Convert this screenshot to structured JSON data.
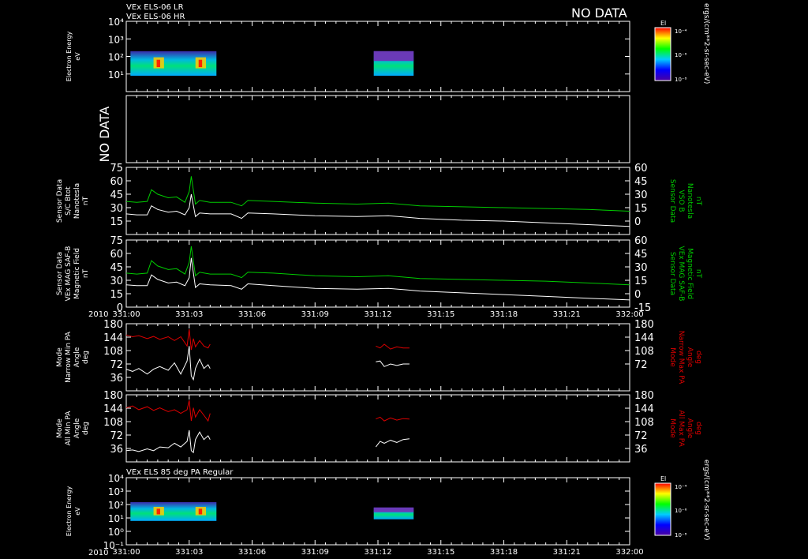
{
  "header": {
    "line1": "VEx ELS-06 LR",
    "line2": "VEx ELS-06 HR",
    "no_data": "NO DATA"
  },
  "bottom_title": "VEx ELS 85 deg PA Regular",
  "year": "2010",
  "colorbar": {
    "title": "El",
    "ticks": [
      "10⁻⁴",
      "10⁻⁶",
      "10⁻⁸"
    ],
    "unit_label": "ergs/(cm**2-sr-sec-eV)"
  },
  "colors": {
    "background": "#000000",
    "primary_trace": "#ffffff",
    "green_trace": "#00cc00",
    "red_trace": "#dd0000"
  },
  "chart_data": [
    {
      "type": "heatmap",
      "id": "energy_top",
      "ylabel": [
        "Electron Energy",
        "eV"
      ],
      "ytick_labels": [
        "10⁴",
        "10³",
        "10²",
        "10¹"
      ],
      "yscale": "log",
      "ylim": [
        1,
        10000
      ],
      "time_blocks": [
        {
          "start": "331:00.2",
          "end": "331:04.3",
          "energy_low_eV": 8,
          "energy_high_eV": 200
        },
        {
          "start": "331:11.8",
          "end": "331:13.7",
          "energy_low_eV": 8,
          "energy_high_eV": 200
        }
      ]
    },
    {
      "type": "empty",
      "id": "no_data_panel",
      "label": "NO DATA"
    },
    {
      "type": "line",
      "id": "sc_bmag",
      "ylabel_left": [
        "Sensor Data",
        "S/C Btot",
        "Nanotesla",
        "nT"
      ],
      "ylabel_right": [
        "Sensor Data",
        "VSO B",
        "Nanotesla",
        "nT"
      ],
      "yticks_left": [
        15,
        30,
        45,
        60,
        75
      ],
      "yticks_right": [
        0,
        15,
        30,
        45,
        60
      ],
      "ylim": [
        0,
        75
      ],
      "series": [
        {
          "color": "white",
          "x": [
            0,
            0.5,
            1.0,
            1.2,
            1.5,
            2.0,
            2.4,
            2.8,
            3.0,
            3.1,
            3.3,
            3.5,
            4.0,
            5.0,
            5.5,
            5.8,
            7.0,
            9.0,
            11.0,
            12.5,
            14.0,
            16.0,
            18.0,
            20.0,
            22.0,
            24.0
          ],
          "y": [
            23,
            22,
            22,
            32,
            28,
            25,
            26,
            22,
            30,
            45,
            20,
            24,
            23,
            23,
            18,
            24,
            23,
            21,
            20,
            21,
            18,
            16,
            15,
            13,
            11,
            9
          ]
        },
        {
          "color": "green",
          "x": [
            0,
            0.5,
            1.0,
            1.2,
            1.5,
            2.0,
            2.4,
            2.8,
            3.0,
            3.1,
            3.3,
            3.5,
            4.0,
            5.0,
            5.5,
            5.8,
            7.0,
            9.0,
            11.0,
            12.5,
            14.0,
            16.0,
            18.0,
            20.0,
            22.0,
            24.0
          ],
          "y": [
            37,
            36,
            37,
            50,
            45,
            41,
            42,
            36,
            48,
            65,
            34,
            38,
            36,
            36,
            32,
            38,
            37,
            35,
            34,
            35,
            32,
            31,
            30,
            29,
            28,
            26
          ]
        }
      ]
    },
    {
      "type": "line",
      "id": "mag_saf",
      "ylabel_left": [
        "Sensor Data",
        "VEx MAG SAF-B",
        "Magnetic Field",
        "nT"
      ],
      "ylabel_right": [
        "Sensor Data",
        "VEx MAG SAF-B",
        "Magnetic Field",
        "nT"
      ],
      "yticks_left": [
        0,
        15,
        30,
        45,
        60,
        75
      ],
      "yticks_right": [
        -15,
        0,
        15,
        30,
        45,
        60
      ],
      "ylim": [
        0,
        75
      ],
      "series": [
        {
          "color": "white",
          "x": [
            0,
            0.5,
            1.0,
            1.2,
            1.5,
            2.0,
            2.4,
            2.8,
            3.0,
            3.1,
            3.3,
            3.5,
            4.0,
            5.0,
            5.5,
            5.8,
            7.0,
            9.0,
            11.0,
            12.5,
            14.0,
            16.0,
            18.0,
            20.0,
            22.0,
            24.0
          ],
          "y": [
            25,
            24,
            24,
            36,
            31,
            27,
            28,
            24,
            33,
            55,
            22,
            26,
            25,
            24,
            20,
            26,
            24,
            21,
            20,
            21,
            18,
            16,
            14,
            12,
            10,
            8
          ]
        },
        {
          "color": "green",
          "x": [
            0,
            0.5,
            1.0,
            1.2,
            1.5,
            2.0,
            2.4,
            2.8,
            3.0,
            3.1,
            3.3,
            3.5,
            4.0,
            5.0,
            5.5,
            5.8,
            7.0,
            9.0,
            11.0,
            12.5,
            14.0,
            16.0,
            18.0,
            20.0,
            22.0,
            24.0
          ],
          "y": [
            38,
            37,
            38,
            52,
            46,
            42,
            43,
            37,
            50,
            68,
            35,
            39,
            37,
            37,
            33,
            39,
            38,
            35,
            34,
            35,
            32,
            31,
            30,
            29,
            27,
            25
          ]
        }
      ]
    },
    {
      "type": "line",
      "id": "narrow_pa",
      "ylabel_left": [
        "Mode",
        "Narrow Min PA",
        "Angle",
        "deg"
      ],
      "ylabel_right": [
        "Mode",
        "Narrow Max PA",
        "Angle",
        "deg"
      ],
      "yticks_left": [
        36,
        72,
        108,
        144,
        180
      ],
      "yticks_right": [
        72,
        108,
        144,
        180
      ],
      "ylim": [
        0,
        180
      ],
      "series": [
        {
          "color": "white",
          "segments": [
            {
              "x": [
                0,
                0.3,
                0.6,
                1.0,
                1.3,
                1.6,
                2.0,
                2.3,
                2.6,
                2.9,
                3.0,
                3.1,
                3.2,
                3.3,
                3.5,
                3.7,
                3.9,
                4.0
              ],
              "y": [
                58,
                52,
                60,
                45,
                58,
                65,
                55,
                75,
                45,
                80,
                120,
                40,
                30,
                60,
                85,
                60,
                70,
                60
              ]
            },
            {
              "x": [
                11.9,
                12.1,
                12.3,
                12.6,
                12.9,
                13.2,
                13.5
              ],
              "y": [
                78,
                80,
                65,
                72,
                68,
                72,
                72
              ]
            }
          ]
        },
        {
          "color": "red",
          "segments": [
            {
              "x": [
                0,
                0.3,
                0.6,
                1.0,
                1.3,
                1.6,
                2.0,
                2.3,
                2.6,
                2.9,
                3.0,
                3.1,
                3.2,
                3.3,
                3.5,
                3.7,
                3.9,
                4.0
              ],
              "y": [
                150,
                145,
                148,
                140,
                146,
                138,
                145,
                135,
                145,
                120,
                165,
                110,
                140,
                118,
                135,
                120,
                115,
                125
              ]
            },
            {
              "x": [
                11.9,
                12.1,
                12.3,
                12.6,
                12.9,
                13.2,
                13.5
              ],
              "y": [
                120,
                115,
                125,
                112,
                118,
                115,
                115
              ]
            }
          ]
        }
      ]
    },
    {
      "type": "line",
      "id": "all_pa",
      "ylabel_left": [
        "Mode",
        "All Min PA",
        "Angle",
        "deg"
      ],
      "ylabel_right": [
        "Mode",
        "All Max PA",
        "Angle",
        "deg"
      ],
      "yticks_left": [
        36,
        72,
        108,
        144,
        180
      ],
      "yticks_right": [
        36,
        72,
        108,
        144,
        180
      ],
      "ylim": [
        0,
        180
      ],
      "series": [
        {
          "color": "white",
          "segments": [
            {
              "x": [
                0,
                0.3,
                0.6,
                1.0,
                1.3,
                1.6,
                2.0,
                2.3,
                2.6,
                2.9,
                3.0,
                3.1,
                3.2,
                3.3,
                3.5,
                3.7,
                3.9,
                4.0
              ],
              "y": [
                30,
                32,
                28,
                35,
                30,
                40,
                38,
                50,
                40,
                55,
                85,
                30,
                25,
                60,
                80,
                60,
                70,
                60
              ]
            },
            {
              "x": [
                11.9,
                12.1,
                12.3,
                12.6,
                12.9,
                13.2,
                13.5
              ],
              "y": [
                40,
                55,
                50,
                58,
                52,
                60,
                62
              ]
            }
          ]
        },
        {
          "color": "red",
          "segments": [
            {
              "x": [
                0,
                0.3,
                0.6,
                1.0,
                1.3,
                1.6,
                2.0,
                2.3,
                2.6,
                2.9,
                3.0,
                3.1,
                3.2,
                3.3,
                3.5,
                3.7,
                3.9,
                4.0
              ],
              "y": [
                145,
                150,
                140,
                148,
                138,
                145,
                135,
                140,
                130,
                140,
                165,
                110,
                145,
                120,
                140,
                125,
                110,
                130
              ]
            },
            {
              "x": [
                11.9,
                12.1,
                12.3,
                12.6,
                12.9,
                13.2,
                13.5
              ],
              "y": [
                115,
                120,
                110,
                118,
                112,
                116,
                115
              ]
            }
          ]
        }
      ]
    },
    {
      "type": "heatmap",
      "id": "energy_bottom",
      "ylabel": [
        "Electron Energy",
        "eV"
      ],
      "ytick_labels": [
        "10⁴",
        "10³",
        "10²",
        "10¹",
        "10⁰",
        "10⁻¹"
      ],
      "yscale": "log",
      "ylim": [
        0.1,
        10000
      ],
      "time_blocks": [
        {
          "start": "331:00.2",
          "end": "331:04.3",
          "energy_low_eV": 6,
          "energy_high_eV": 150
        },
        {
          "start": "331:11.8",
          "end": "331:13.7",
          "energy_low_eV": 8,
          "energy_high_eV": 60
        }
      ]
    }
  ],
  "x_axis": {
    "tick_labels": [
      "331:00",
      "331:03",
      "331:06",
      "331:09",
      "331:12",
      "331:15",
      "331:18",
      "331:21",
      "332:00"
    ],
    "xlim_hours": [
      0,
      24
    ]
  }
}
